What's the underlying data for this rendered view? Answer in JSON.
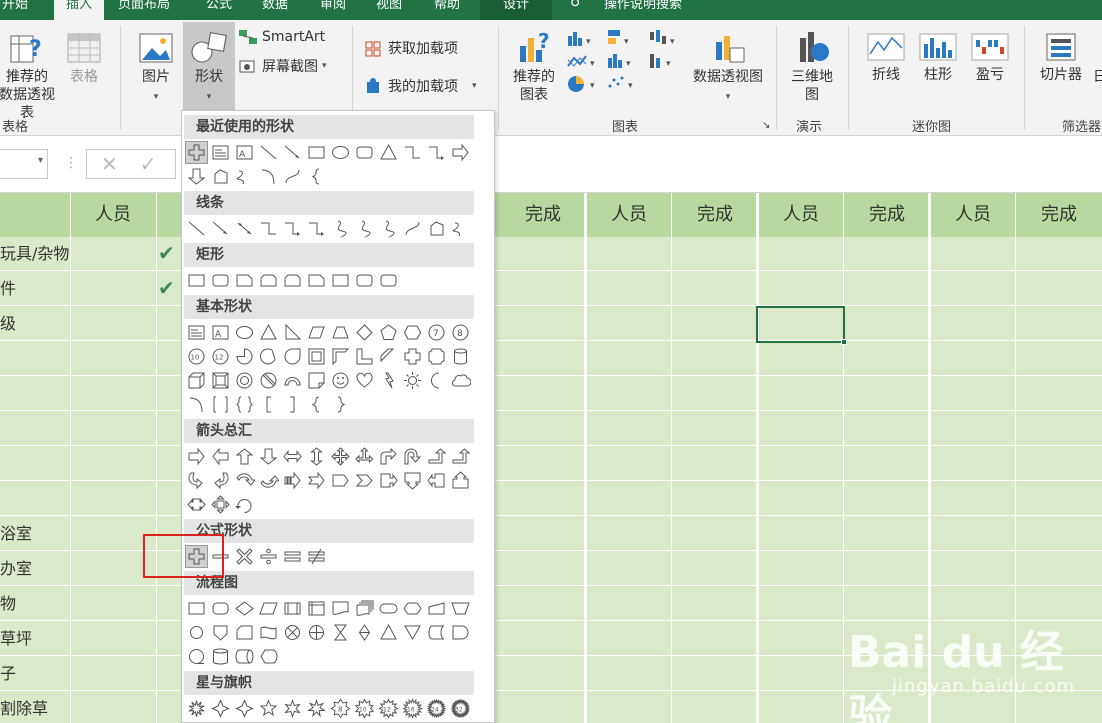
{
  "ribbon_tabs": [
    "开始",
    "插入",
    "页面布局",
    "公式",
    "数据",
    "审阅",
    "视图",
    "帮助",
    "设计",
    "操作说明搜索"
  ],
  "ribbon": {
    "pivot": "推荐的\n数据透视表",
    "table": "表格",
    "tables_group": "表格",
    "picture": "图片",
    "shapes": "形状",
    "smartart": "SmartArt",
    "screenshot": "屏幕截图",
    "get_addins": "获取加载项",
    "my_addins": "我的加载项",
    "rec_charts": "推荐的\n图表",
    "pivot_chart": "数据透视图",
    "charts_group": "图表",
    "map3d": "三维地\n图",
    "tours_group": "演示",
    "spark_line": "折线",
    "spark_column": "柱形",
    "spark_winloss": "盈亏",
    "sparklines_group": "迷你图",
    "slicer": "切片器",
    "timeline_partial": "日",
    "filter_group": "筛选器"
  },
  "formula_bar": {
    "cancel": "✕",
    "enter": "✓"
  },
  "sheet": {
    "headers": [
      "人员",
      "完成",
      "人员",
      "完成",
      "人员",
      "完成",
      "人员",
      "完成"
    ],
    "row_labels": [
      "玩具/杂物",
      "件",
      "级",
      "",
      "",
      "",
      "",
      "",
      "浴室",
      "办室",
      "物",
      "草坪",
      "子",
      "割除草"
    ]
  },
  "shapes_menu": {
    "sections": [
      "最近使用的形状",
      "线条",
      "矩形",
      "基本形状",
      "箭头总汇",
      "公式形状",
      "流程图",
      "星与旗帜"
    ]
  },
  "watermark": {
    "main": "Bai du 经验",
    "sub": "jingyan.baidu.com"
  }
}
